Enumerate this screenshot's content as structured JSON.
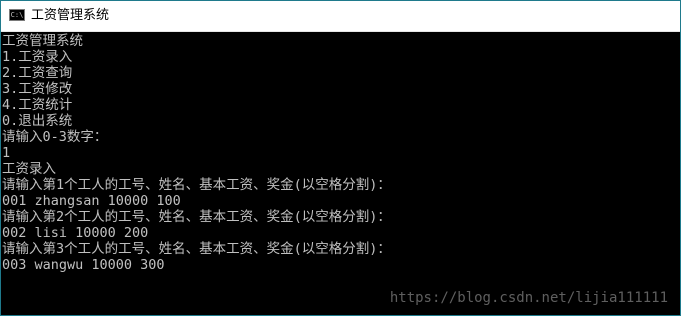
{
  "window": {
    "title": "工资管理系统",
    "icon": "console-icon",
    "icon_text": "C:\\"
  },
  "console": {
    "lines": [
      "工资管理系统",
      "1.工资录入",
      "2.工资查询",
      "3.工资修改",
      "4.工资统计",
      "0.退出系统",
      "请输入0-3数字：",
      "1",
      "工资录入",
      "请输入第1个工人的工号、姓名、基本工资、奖金(以空格分割)：",
      "001 zhangsan 10000 100",
      "请输入第2个工人的工号、姓名、基本工资、奖金(以空格分割)：",
      "002 lisi 10000 200",
      "请输入第3个工人的工号、姓名、基本工资、奖金(以空格分割)：",
      "003 wangwu 10000 300"
    ]
  },
  "watermark": {
    "text": "https://blog.csdn.net/lijia111111"
  }
}
